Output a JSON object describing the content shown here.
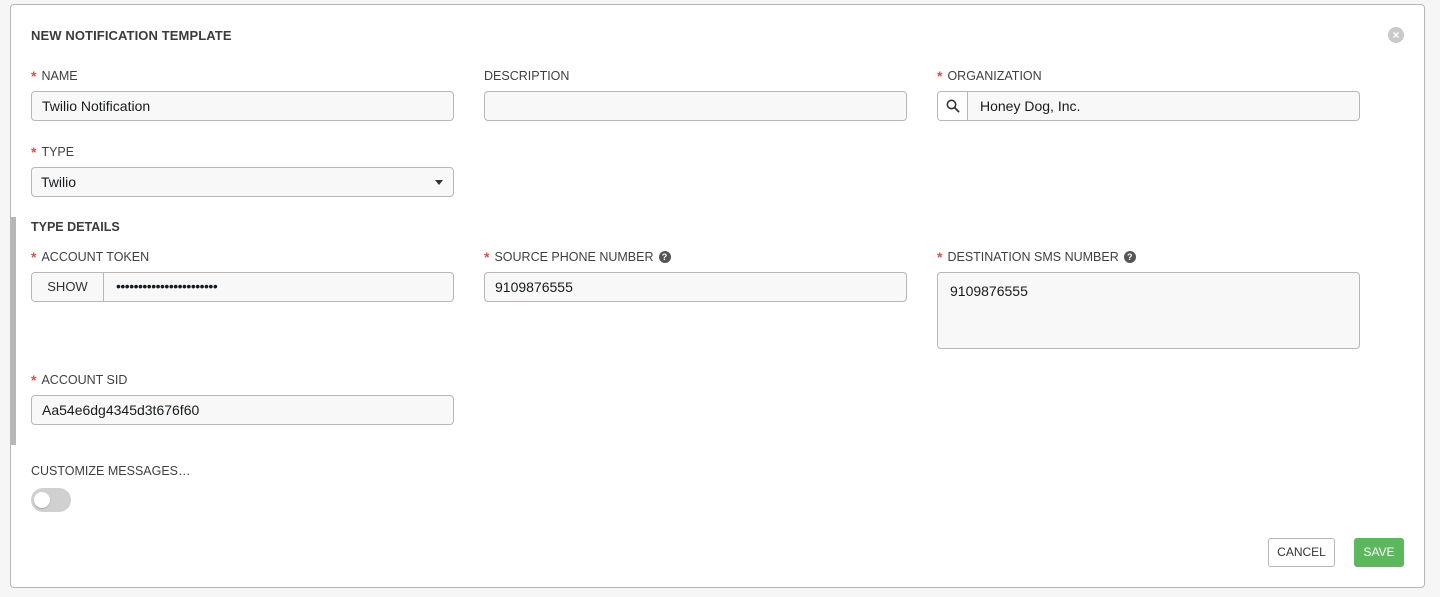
{
  "header": {
    "title": "NEW NOTIFICATION TEMPLATE",
    "close_icon": "close-circle-icon"
  },
  "fields": {
    "name": {
      "label": "NAME",
      "required": true,
      "value": "Twilio Notification"
    },
    "description": {
      "label": "DESCRIPTION",
      "required": false,
      "value": ""
    },
    "organization": {
      "label": "ORGANIZATION",
      "required": true,
      "value": "Honey Dog, Inc.",
      "icon": "search-icon"
    },
    "type": {
      "label": "TYPE",
      "required": true,
      "value": "Twilio"
    }
  },
  "type_details": {
    "title": "TYPE DETAILS",
    "account_token": {
      "label": "ACCOUNT TOKEN",
      "required": true,
      "show_label": "SHOW",
      "value": "•••••••••••••••••••••••"
    },
    "source_phone": {
      "label": "SOURCE PHONE NUMBER",
      "required": true,
      "value": "9109876555",
      "help_icon": "question-circle-icon"
    },
    "destination_sms": {
      "label": "DESTINATION SMS NUMBER",
      "required": true,
      "value": "9109876555",
      "help_icon": "question-circle-icon"
    },
    "account_sid": {
      "label": "ACCOUNT SID",
      "required": true,
      "value": "Aa54e6dg4345d3t676f60"
    }
  },
  "customize": {
    "label": "CUSTOMIZE MESSAGES…",
    "enabled": false
  },
  "actions": {
    "cancel_label": "CANCEL",
    "save_label": "SAVE"
  },
  "colors": {
    "required": "#d9534f",
    "save": "#5cb85c",
    "border": "#b7b7b7"
  }
}
